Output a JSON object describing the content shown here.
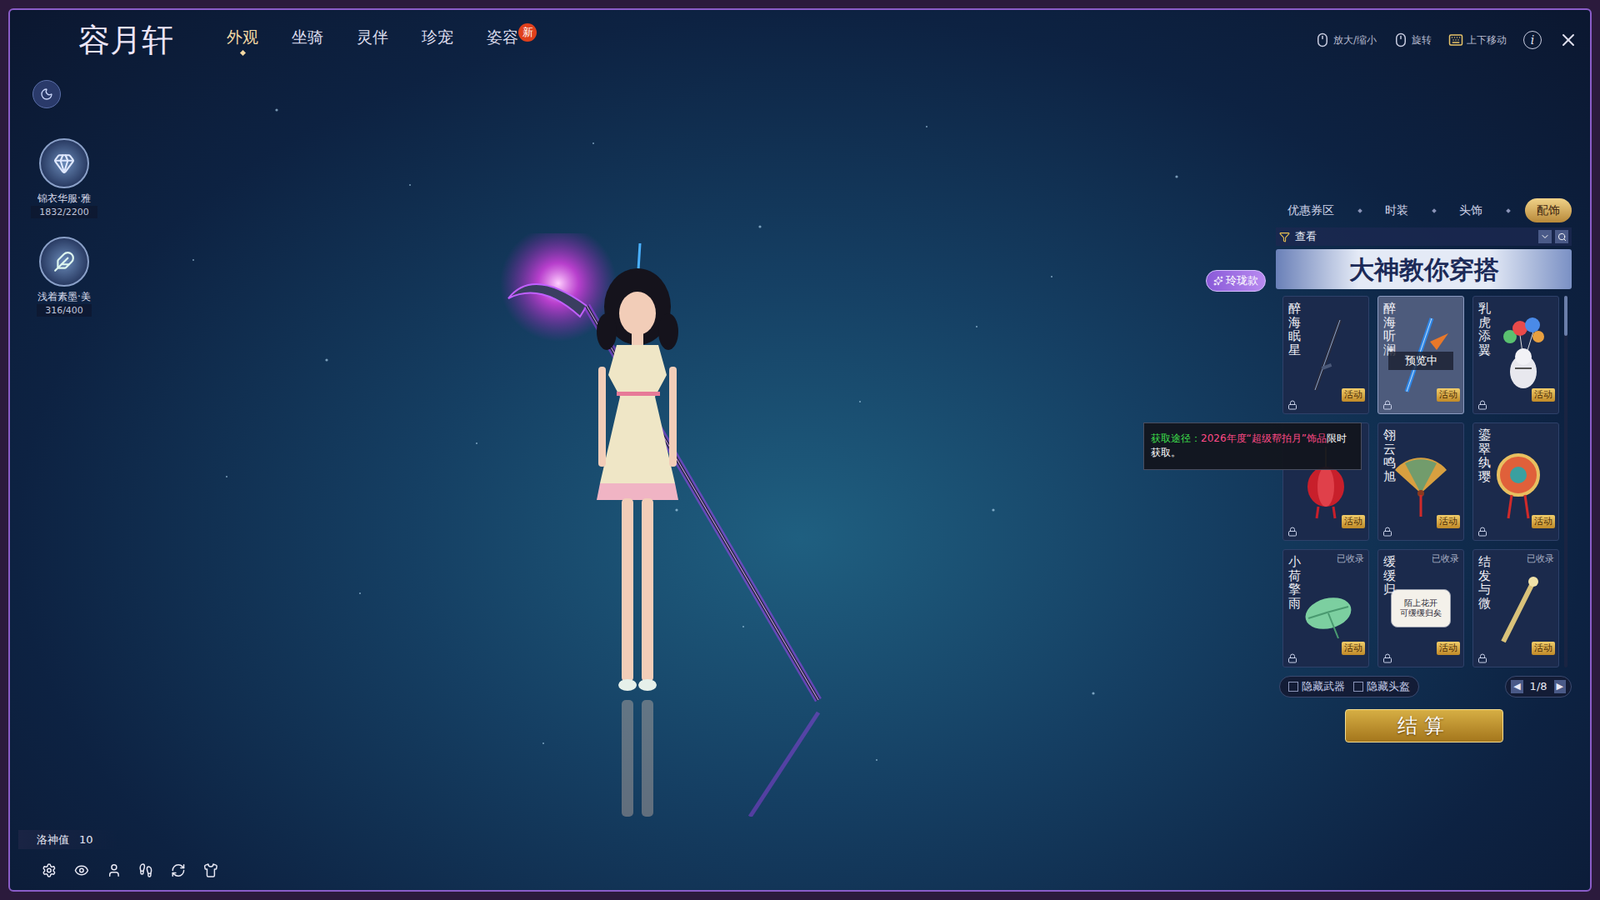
{
  "header": {
    "logo": "容月轩",
    "tabs": [
      {
        "label": "外观",
        "selected": true
      },
      {
        "label": "坐骑",
        "selected": false
      },
      {
        "label": "灵伴",
        "selected": false
      },
      {
        "label": "珍宠",
        "selected": false
      },
      {
        "label": "姿容",
        "selected": false,
        "badge": "新"
      }
    ]
  },
  "controls": [
    {
      "label": "放大/缩小",
      "kind": "mouse"
    },
    {
      "label": "旋转",
      "kind": "mouse"
    },
    {
      "label": "上下移动",
      "kind": "keys"
    }
  ],
  "info": "i",
  "sidebar": {
    "medals": [
      {
        "name": "锦衣华服·雅",
        "progress": "1832/2200",
        "kind": "gem"
      },
      {
        "name": "浅着素墨·美",
        "progress": "316/400",
        "kind": "feather"
      }
    ]
  },
  "style_button": "玲珑款",
  "panel": {
    "tabs": [
      {
        "label": "优惠券区",
        "selected": false
      },
      {
        "label": "时装",
        "selected": false
      },
      {
        "label": "头饰",
        "selected": false
      },
      {
        "label": "配饰",
        "selected": true
      }
    ],
    "filter": "查看",
    "banner": "大神教你穿搭",
    "preview_label": "预览中",
    "items": [
      {
        "name": "醉海眠星",
        "badge": "活动",
        "collected": false,
        "previewing": false,
        "kind": "sword"
      },
      {
        "name": "醉海听澜",
        "badge": "活动",
        "collected": false,
        "previewing": true,
        "kind": "sword-blue"
      },
      {
        "name": "乳虎添翼",
        "badge": "活动",
        "collected": false,
        "previewing": false,
        "kind": "pet"
      },
      {
        "badge": "活动",
        "collected": false,
        "previewing": false,
        "kind": "charm"
      },
      {
        "name": "翎云鸣旭",
        "badge": "活动",
        "collected": false,
        "previewing": false,
        "kind": "fan"
      },
      {
        "name": "鎏翠纨璎",
        "badge": "活动",
        "collected": false,
        "previewing": false,
        "kind": "ornament"
      },
      {
        "name": "小荷擎雨",
        "badge": "活动",
        "collected": true,
        "collected_label": "已收录",
        "previewing": false,
        "kind": "leaf"
      },
      {
        "name": "缓缓归",
        "badge": "活动",
        "collected": true,
        "collected_label": "已收录",
        "previewing": false,
        "kind": "calligraphy",
        "art_text": [
          "陌上花开",
          "可缓缓归矣"
        ]
      },
      {
        "name": "结发与微",
        "badge": "活动",
        "collected": true,
        "collected_label": "已收录",
        "previewing": false,
        "kind": "hairpin"
      }
    ],
    "checkboxes": [
      {
        "label": "隐藏武器",
        "checked": false
      },
      {
        "label": "隐藏头盔",
        "checked": false
      }
    ],
    "pagination": {
      "prev": "◀",
      "page": "1/8",
      "next": "▶"
    },
    "checkout": "结算"
  },
  "tooltip": {
    "segments": [
      {
        "text": "获取途径：",
        "color": "#3ddc4a"
      },
      {
        "text": "2026年度“超级帮拍月”饰品",
        "color": "#ff4a86"
      },
      {
        "text": "限时获取。",
        "color": "#ffffff"
      }
    ]
  },
  "footer": {
    "stat_label": "洛神值",
    "stat_value": "10"
  }
}
